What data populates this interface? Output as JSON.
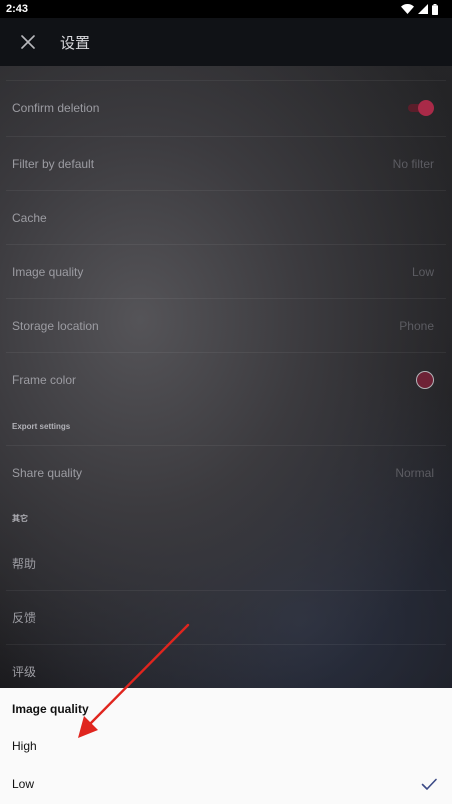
{
  "status_bar": {
    "time": "2:43",
    "icons": [
      "wifi-icon",
      "cell-signal-icon",
      "battery-icon"
    ]
  },
  "app_bar": {
    "close_icon": "close-icon",
    "title": "设置"
  },
  "settings": {
    "confirm_deletion": {
      "label": "Confirm deletion",
      "toggle_on": true
    },
    "filter_by_default": {
      "label": "Filter by default",
      "value": "No filter"
    },
    "cache": {
      "label": "Cache"
    },
    "image_quality": {
      "label": "Image quality",
      "value": "Low"
    },
    "storage_location": {
      "label": "Storage location",
      "value": "Phone"
    },
    "frame_color": {
      "label": "Frame color",
      "color": "#6e2236"
    },
    "export_header": "Export settings",
    "share_quality": {
      "label": "Share quality",
      "value": "Normal"
    },
    "other_header": "其它",
    "help": {
      "label": "帮助"
    },
    "feedback": {
      "label": "反馈"
    },
    "rating": {
      "label": "评级"
    }
  },
  "dialog": {
    "title": "Image quality",
    "options": [
      {
        "label": "High",
        "selected": false
      },
      {
        "label": "Low",
        "selected": true
      }
    ],
    "check_icon": "checkmark-icon"
  },
  "colors": {
    "accent": "#a92a48",
    "annotation_arrow": "#e0251e",
    "sheet_background": "#fafafa"
  }
}
